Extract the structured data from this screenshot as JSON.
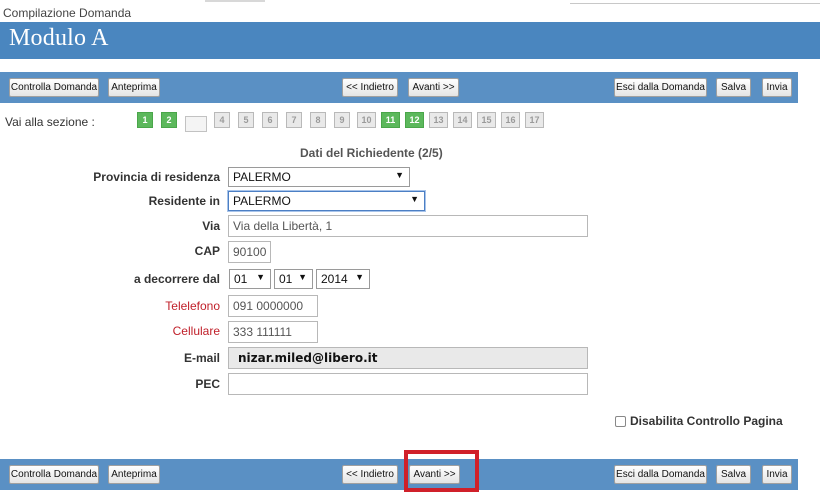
{
  "app": {
    "title": "Compilazione Domanda",
    "form_name": "Modulo A"
  },
  "toolbar": {
    "controlla": "Controlla Domanda",
    "anteprima": "Anteprima",
    "indietro": "<< Indietro",
    "avanti": "Avanti >>",
    "esci": "Esci dalla Domanda",
    "salva": "Salva",
    "invia": "Invia"
  },
  "sections": {
    "label": "Vai alla sezione :",
    "items": [
      {
        "num": "1",
        "state": "done"
      },
      {
        "num": "2",
        "state": "done"
      },
      {
        "num": "",
        "state": "current"
      },
      {
        "num": "4",
        "state": "todo"
      },
      {
        "num": "5",
        "state": "todo"
      },
      {
        "num": "6",
        "state": "todo"
      },
      {
        "num": "7",
        "state": "todo"
      },
      {
        "num": "8",
        "state": "todo"
      },
      {
        "num": "9",
        "state": "todo"
      },
      {
        "num": "10",
        "state": "todo"
      },
      {
        "num": "11",
        "state": "done"
      },
      {
        "num": "12",
        "state": "done"
      },
      {
        "num": "13",
        "state": "todo"
      },
      {
        "num": "14",
        "state": "todo"
      },
      {
        "num": "15",
        "state": "todo"
      },
      {
        "num": "16",
        "state": "todo"
      },
      {
        "num": "17",
        "state": "todo"
      }
    ]
  },
  "form": {
    "title": "Dati del Richiedente (2/5)",
    "provincia": {
      "label": "Provincia di residenza",
      "value": "PALERMO"
    },
    "residente": {
      "label": "Residente in",
      "value": "PALERMO"
    },
    "via": {
      "label": "Via",
      "value": "Via della Libertà, 1"
    },
    "cap": {
      "label": "CAP",
      "value": "90100"
    },
    "decorrenza": {
      "label": "a decorrere dal",
      "day": "01",
      "month": "01",
      "year": "2014"
    },
    "telefono": {
      "label": "Telelefono",
      "value": "091 0000000"
    },
    "cellulare": {
      "label": "Cellulare",
      "value": "333 111111"
    },
    "email": {
      "label": "E-mail",
      "value": "nizar.miled@libero.it"
    },
    "pec": {
      "label": "PEC",
      "value": ""
    },
    "disabilita": {
      "label": "Disabilita Controllo Pagina",
      "checked": false
    }
  },
  "colors": {
    "header": "#4a86bf",
    "toolbar": "#5a90c4",
    "done": "#5cb85c",
    "required": "#c0202a",
    "highlight": "#d0202a"
  }
}
